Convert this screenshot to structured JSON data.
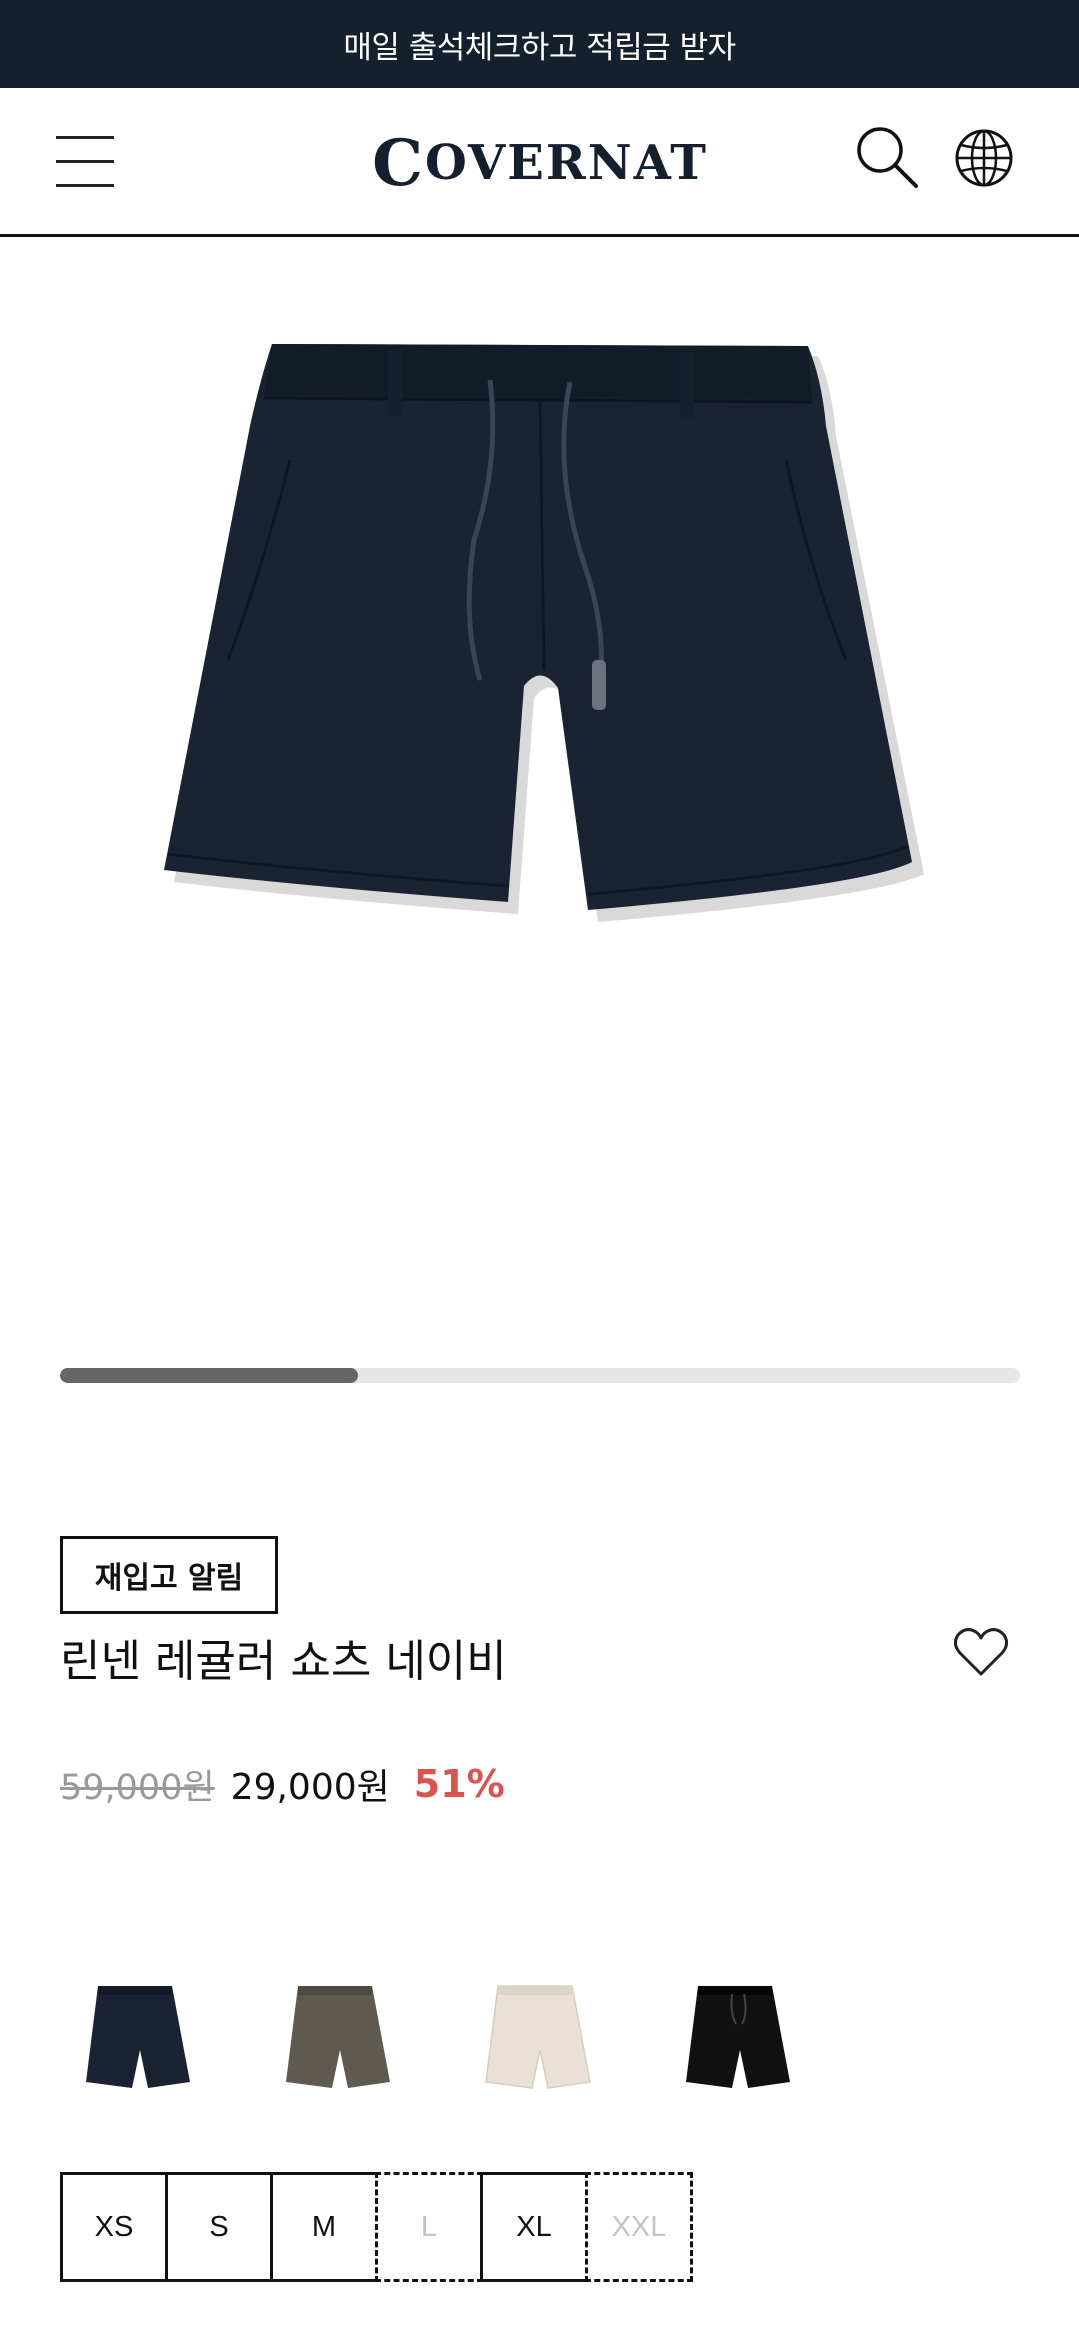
{
  "banner": {
    "text": "매일 출석체크하고 적립금 받자"
  },
  "header": {
    "logo_initial": "C",
    "logo_rest": "OVERNAT",
    "menu_icon": "hamburger-menu-icon",
    "search_icon": "search-icon",
    "language_icon": "globe-icon"
  },
  "gallery": {
    "image": "navy-linen-shorts",
    "progress": 0.31
  },
  "product": {
    "restock_label": "재입고 알림",
    "name": "린넨 레귤러 쇼츠 네이비",
    "wishlist_icon": "heart-outline-icon",
    "price_original": "59,000원",
    "price_sale": "29,000원",
    "discount": "51%"
  },
  "colors": [
    {
      "name": "navy",
      "hex": "#1b2333"
    },
    {
      "name": "khaki",
      "hex": "#5e5a4f"
    },
    {
      "name": "beige",
      "hex": "#e9e1d6"
    },
    {
      "name": "black",
      "hex": "#111111"
    }
  ],
  "sizes": [
    {
      "label": "XS",
      "available": true
    },
    {
      "label": "S",
      "available": true
    },
    {
      "label": "M",
      "available": true
    },
    {
      "label": "L",
      "available": false
    },
    {
      "label": "XL",
      "available": true
    },
    {
      "label": "XXL",
      "available": false
    }
  ],
  "theme": {
    "banner_bg": "#14202e",
    "discount_color": "#d9534f"
  }
}
